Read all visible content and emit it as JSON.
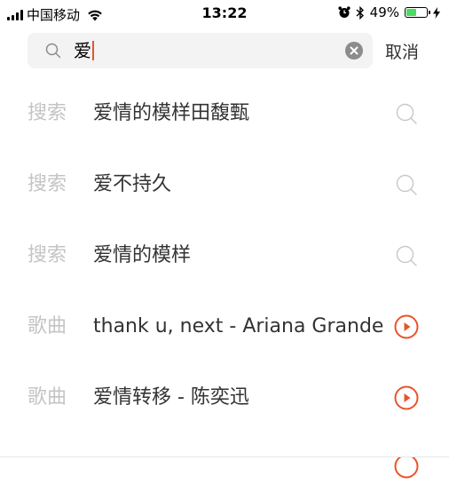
{
  "status_bar": {
    "carrier": "中国移动",
    "time": "13:22",
    "battery_percent": "49%",
    "battery_level": 0.49,
    "icons": [
      "signal-icon",
      "wifi-icon",
      "alarm-icon",
      "bluetooth-icon",
      "battery-icon",
      "charging-icon"
    ]
  },
  "search": {
    "query": "爱",
    "cancel_label": "取消",
    "accent_color": "#e8542a"
  },
  "suggestions": [
    {
      "kind": "搜索",
      "text": "爱情的模样田馥甄",
      "action": "search-icon"
    },
    {
      "kind": "搜索",
      "text": "爱不持久",
      "action": "search-icon"
    },
    {
      "kind": "搜索",
      "text": "爱情的模样",
      "action": "search-icon"
    },
    {
      "kind": "歌曲",
      "text": "thank u, next - Ariana Grande",
      "action": "play-icon"
    },
    {
      "kind": "歌曲",
      "text": "爱情转移 - 陈奕迅",
      "action": "play-icon"
    }
  ]
}
